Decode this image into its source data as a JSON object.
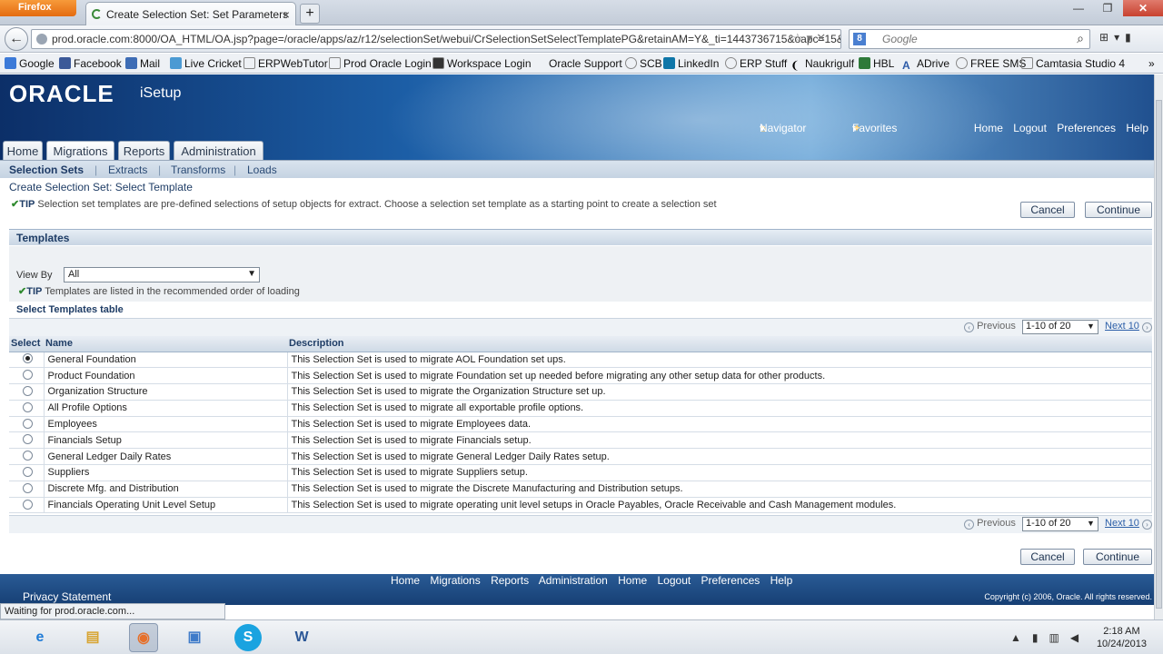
{
  "browser": {
    "app_button": "Firefox",
    "tab_title": "Create Selection Set: Set Parameters",
    "new_tab": "+",
    "url": "prod.oracle.com:8000/OA_HTML/OA.jsp?page=/oracle/apps/az/r12/selectionSet/webui/CrSelectionSetSelectTemplatePG&retainAM=Y&_ti=1443736715&oapc=15&",
    "search_engine": "Google",
    "search_placeholder": "Google",
    "bookmarks": [
      "Google",
      "Facebook",
      "Mail",
      "Live Cricket",
      "ERPWebTutor",
      "Prod Oracle Login",
      "Workspace Login",
      "Oracle Support",
      "SCB",
      "LinkedIn",
      "ERP Stuff",
      "Naukrigulf",
      "HBL",
      "ADrive",
      "FREE SMS",
      "Camtasia Studio 4"
    ],
    "status": "Waiting for prod.oracle.com..."
  },
  "header": {
    "logo": "ORACLE",
    "product": "iSetup",
    "navigator": "Navigator",
    "favorites": "Favorites",
    "global_links": [
      "Home",
      "Logout",
      "Preferences",
      "Help"
    ]
  },
  "tabs": [
    "Home",
    "Migrations",
    "Reports",
    "Administration"
  ],
  "active_tab": "Migrations",
  "subtabs": [
    "Selection Sets",
    "Extracts",
    "Transforms",
    "Loads"
  ],
  "page": {
    "title": "Create Selection Set: Select Template",
    "tip_label": "TIP",
    "tip_text": "Selection set templates are pre-defined selections of setup objects for extract. Choose a selection set template as a starting point to create a selection set",
    "cancel": "Cancel",
    "continue": "Continue",
    "section": "Templates",
    "view_by_label": "View By",
    "view_by_value": "All",
    "tip2_text": "Templates are listed in the recommended order of loading",
    "table_title": "Select Templates table",
    "pager": {
      "previous": "Previous",
      "range": "1-10 of 20",
      "next": "Next 10"
    },
    "columns": {
      "select": "Select",
      "name": "Name",
      "description": "Description"
    },
    "rows": [
      {
        "name": "General Foundation",
        "description": "This Selection Set is used to migrate AOL Foundation set ups.",
        "selected": true
      },
      {
        "name": "Product Foundation",
        "description": "This Selection Set is used to migrate Foundation set up needed before migrating any other setup data for other products.",
        "selected": false
      },
      {
        "name": "Organization Structure",
        "description": "This Selection Set is used to migrate the Organization Structure set up.",
        "selected": false
      },
      {
        "name": "All Profile Options",
        "description": "This Selection Set is used to migrate all exportable profile options.",
        "selected": false
      },
      {
        "name": "Employees",
        "description": "This Selection Set is used to migrate Employees data.",
        "selected": false
      },
      {
        "name": "Financials Setup",
        "description": "This Selection Set is used to migrate Financials setup.",
        "selected": false
      },
      {
        "name": "General Ledger Daily Rates",
        "description": "This Selection Set is used to migrate General Ledger Daily Rates setup.",
        "selected": false
      },
      {
        "name": "Suppliers",
        "description": "This Selection Set is used to migrate Suppliers setup.",
        "selected": false
      },
      {
        "name": "Discrete Mfg. and Distribution",
        "description": "This Selection Set is used to migrate the Discrete Manufacturing and Distribution setups.",
        "selected": false
      },
      {
        "name": "Financials Operating Unit Level Setup",
        "description": "This Selection Set is used to migrate operating unit level setups in Oracle Payables, Oracle Receivable and Cash Management modules.",
        "selected": false
      }
    ]
  },
  "footer": {
    "links": [
      "Home",
      "Migrations",
      "Reports",
      "Administration",
      "Home",
      "Logout",
      "Preferences",
      "Help"
    ],
    "privacy": "Privacy Statement",
    "copyright": "Copyright (c) 2006, Oracle. All rights reserved."
  },
  "taskbar": {
    "time": "2:18 AM",
    "date": "10/24/2013"
  }
}
